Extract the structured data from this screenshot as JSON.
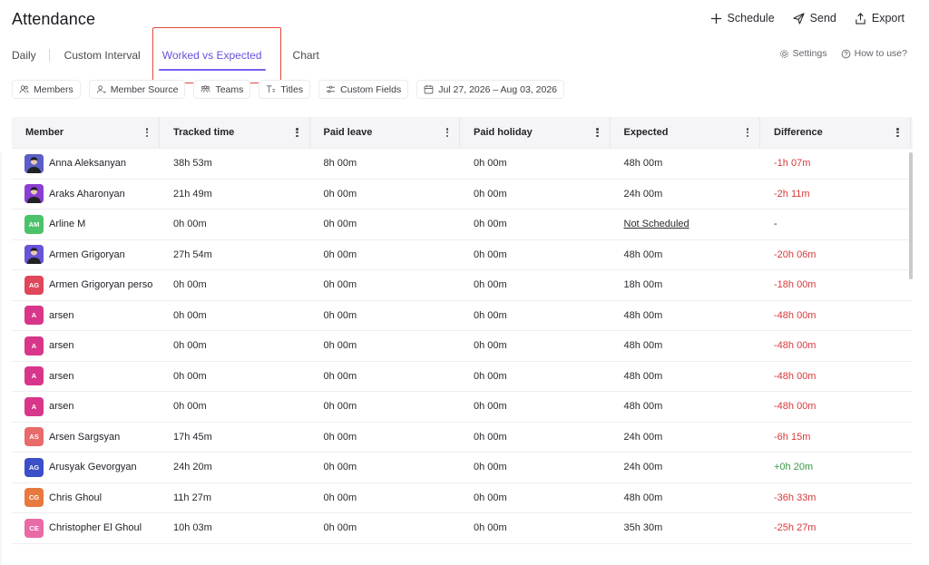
{
  "page": {
    "title": "Attendance"
  },
  "top_actions": [
    {
      "label": "Schedule",
      "icon": "plus-icon"
    },
    {
      "label": "Send",
      "icon": "send-icon"
    },
    {
      "label": "Export",
      "icon": "export-icon"
    }
  ],
  "tabs": [
    {
      "label": "Daily"
    },
    {
      "label": "Custom Interval"
    },
    {
      "label": "Worked vs Expected",
      "active": true
    },
    {
      "label": "Chart"
    }
  ],
  "right_links": {
    "settings": "Settings",
    "how_to": "How to use?"
  },
  "filters": {
    "members": "Members",
    "member_source": "Member Source",
    "teams": "Teams",
    "titles": "Titles",
    "custom_fields": "Custom Fields",
    "date_range": "Jul 27, 2026 – Aug 03, 2026"
  },
  "columns": [
    "Member",
    "Tracked time",
    "Paid leave",
    "Paid holiday",
    "Expected",
    "Difference"
  ],
  "colors": {
    "accent": "#6a4fe0",
    "highlight": "#e34a3b",
    "negative": "#d8393b",
    "positive": "#3a9a45"
  },
  "rows": [
    {
      "name": "Anna Aleksanyan",
      "initials": "",
      "avatar_color": "#5b5fc7",
      "photo": true,
      "tracked": "38h 53m",
      "paid_leave": "8h 00m",
      "paid_holiday": "0h 00m",
      "expected": "48h 00m",
      "difference": "-1h 07m",
      "diff_type": "neg"
    },
    {
      "name": "Araks Aharonyan",
      "initials": "",
      "avatar_color": "#8a3fd1",
      "photo": true,
      "tracked": "21h 49m",
      "paid_leave": "0h 00m",
      "paid_holiday": "0h 00m",
      "expected": "24h 00m",
      "difference": "-2h 11m",
      "diff_type": "neg"
    },
    {
      "name": "Arline M",
      "initials": "AM",
      "avatar_color": "#4cc26a",
      "photo": false,
      "tracked": "0h 00m",
      "paid_leave": "0h 00m",
      "paid_holiday": "0h 00m",
      "expected": "Not Scheduled",
      "expected_link": true,
      "difference": "-",
      "diff_type": "none"
    },
    {
      "name": "Armen Grigoryan",
      "initials": "",
      "avatar_color": "#6655d8",
      "photo": true,
      "tracked": "27h 54m",
      "paid_leave": "0h 00m",
      "paid_holiday": "0h 00m",
      "expected": "48h 00m",
      "difference": "-20h 06m",
      "diff_type": "neg"
    },
    {
      "name": "Armen Grigoryan perso",
      "initials": "AG",
      "avatar_color": "#e0475a",
      "photo": false,
      "tracked": "0h 00m",
      "paid_leave": "0h 00m",
      "paid_holiday": "0h 00m",
      "expected": "18h 00m",
      "difference": "-18h 00m",
      "diff_type": "neg"
    },
    {
      "name": "arsen",
      "initials": "A",
      "avatar_color": "#d8368a",
      "photo": false,
      "tracked": "0h 00m",
      "paid_leave": "0h 00m",
      "paid_holiday": "0h 00m",
      "expected": "48h 00m",
      "difference": "-48h 00m",
      "diff_type": "neg"
    },
    {
      "name": "arsen",
      "initials": "A",
      "avatar_color": "#d8368a",
      "photo": false,
      "tracked": "0h 00m",
      "paid_leave": "0h 00m",
      "paid_holiday": "0h 00m",
      "expected": "48h 00m",
      "difference": "-48h 00m",
      "diff_type": "neg"
    },
    {
      "name": "arsen",
      "initials": "A",
      "avatar_color": "#d8368a",
      "photo": false,
      "tracked": "0h 00m",
      "paid_leave": "0h 00m",
      "paid_holiday": "0h 00m",
      "expected": "48h 00m",
      "difference": "-48h 00m",
      "diff_type": "neg"
    },
    {
      "name": "arsen",
      "initials": "A",
      "avatar_color": "#d8368a",
      "photo": false,
      "tracked": "0h 00m",
      "paid_leave": "0h 00m",
      "paid_holiday": "0h 00m",
      "expected": "48h 00m",
      "difference": "-48h 00m",
      "diff_type": "neg"
    },
    {
      "name": "Arsen Sargsyan",
      "initials": "AS",
      "avatar_color": "#e86a6a",
      "photo": false,
      "tracked": "17h 45m",
      "paid_leave": "0h 00m",
      "paid_holiday": "0h 00m",
      "expected": "24h 00m",
      "difference": "-6h 15m",
      "diff_type": "neg"
    },
    {
      "name": "Arusyak Gevorgyan",
      "initials": "AG",
      "avatar_color": "#3b4fc8",
      "photo": false,
      "tracked": "24h 20m",
      "paid_leave": "0h 00m",
      "paid_holiday": "0h 00m",
      "expected": "24h 00m",
      "difference": "+0h 20m",
      "diff_type": "pos"
    },
    {
      "name": "Chris Ghoul",
      "initials": "CG",
      "avatar_color": "#e8783e",
      "photo": false,
      "tracked": "11h 27m",
      "paid_leave": "0h 00m",
      "paid_holiday": "0h 00m",
      "expected": "48h 00m",
      "difference": "-36h 33m",
      "diff_type": "neg"
    },
    {
      "name": "Christopher El Ghoul",
      "initials": "CE",
      "avatar_color": "#e96aa6",
      "photo": false,
      "tracked": "10h 03m",
      "paid_leave": "0h 00m",
      "paid_holiday": "0h 00m",
      "expected": "35h 30m",
      "difference": "-25h 27m",
      "diff_type": "neg"
    }
  ]
}
